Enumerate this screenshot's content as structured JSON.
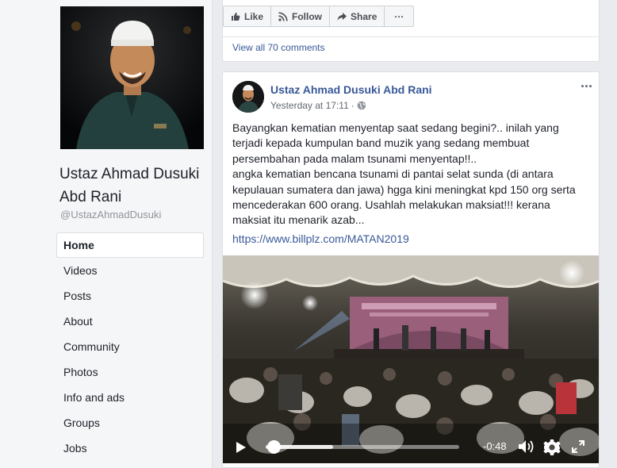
{
  "sidebar": {
    "page_name": "Ustaz Ahmad Dusuki Abd Rani",
    "handle": "@UstazAhmadDusuki",
    "nav": [
      {
        "label": "Home",
        "active": true
      },
      {
        "label": "Videos"
      },
      {
        "label": "Posts"
      },
      {
        "label": "About"
      },
      {
        "label": "Community"
      },
      {
        "label": "Photos"
      },
      {
        "label": "Info and ads"
      },
      {
        "label": "Groups"
      },
      {
        "label": "Jobs"
      }
    ]
  },
  "previous_post": {
    "like_label": "Like",
    "follow_label": "Follow",
    "share_label": "Share",
    "more_label": "···",
    "view_comments": "View all 70 comments"
  },
  "post": {
    "author": "Ustaz Ahmad Dusuki Abd Rani",
    "timestamp": "Yesterday at 17:11",
    "separator": "·",
    "more_label": "···",
    "text_lines": [
      "Bayangkan kematian menyentap saat sedang begini?.. inilah yang",
      "terjadi kepada kumpulan band muzik yang sedang membuat",
      "persembahan pada malam tsunami menyentap!!..",
      "angka kematian bencana tsunami di pantai selat sunda (di antara",
      "kepulauan sumatera dan jawa) hgga kini meningkat kpd 150 org serta",
      "mencederakan 600 orang. Usahlah melakukan maksiat!!! kerana",
      "maksiat itu menarik azab..."
    ],
    "link": "https://www.billplz.com/MATAN2019"
  },
  "video": {
    "time_remaining": "-0:48",
    "progress": 0.04,
    "buffered": 0.35
  },
  "icons": [
    "like-icon",
    "follow-icon",
    "share-icon",
    "globe-icon",
    "play-icon",
    "volume-icon",
    "settings-icon",
    "fullscreen-icon"
  ],
  "colors": {
    "link": "#385898",
    "background": "#e9ebee"
  }
}
